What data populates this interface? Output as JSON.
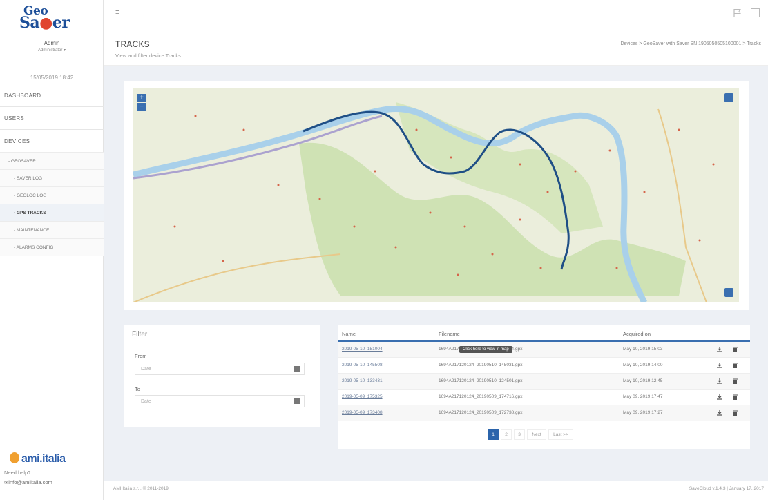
{
  "brand": {
    "logo_top": "Geo",
    "logo_bottom_a": "Sa",
    "logo_bottom_b": "er",
    "company_logo": "ami.italia"
  },
  "user": {
    "name": "Admin",
    "role": "Administrator",
    "datetime": "15/05/2019 18:42"
  },
  "nav": {
    "items": [
      {
        "label": "DASHBOARD"
      },
      {
        "label": "USERS"
      },
      {
        "label": "DEVICES"
      }
    ],
    "subitems": [
      {
        "label": "- GEOSAVER"
      },
      {
        "label": "- SAVER LOG"
      },
      {
        "label": "- GEOLOC LOG"
      },
      {
        "label": "- GPS TRACKS"
      },
      {
        "label": "- MAINTENANCE"
      },
      {
        "label": "- ALARMS CONFIG"
      }
    ]
  },
  "sidebar_footer": {
    "help": "Need help?",
    "email": "info@amiitalia.com"
  },
  "header": {
    "title": "TRACKS",
    "subtitle": "View and filter device Tracks",
    "breadcrumb": "Devices > GeoSaver with Saver SN 1905050505100001 > Tracks"
  },
  "map": {
    "zoom_in": "+",
    "zoom_out": "−",
    "route_color": "#1f4f86",
    "river_color": "#a9d0ea",
    "forest_color": "#cfe2b4"
  },
  "filter": {
    "title": "Filter",
    "from_label": "From",
    "from_placeholder": "Date",
    "to_label": "To",
    "to_placeholder": "Date"
  },
  "table": {
    "headers": {
      "name": "Name",
      "filename": "Filename",
      "acquired": "Acquired on"
    },
    "tooltip": "Click here to view in map",
    "rows": [
      {
        "name": "2019-05-10_151004",
        "filename": "1694A217120124_20190510_151004.gpx",
        "acquired": "May 10, 2019 15:03"
      },
      {
        "name": "2019-05-10_145508",
        "filename": "1694A217120124_20190510_145031.gpx",
        "acquired": "May 10, 2019 14:00"
      },
      {
        "name": "2019-05-10_133431",
        "filename": "1694A217120124_20190510_124501.gpx",
        "acquired": "May 10, 2019 12:45"
      },
      {
        "name": "2019-05-09_175325",
        "filename": "1694A217120124_20190509_174716.gpx",
        "acquired": "May 09, 2019 17:47"
      },
      {
        "name": "2019-05-09_173408",
        "filename": "1694A217120124_20190509_172738.gpx",
        "acquired": "May 09, 2019 17:27"
      }
    ],
    "pager": {
      "p1": "1",
      "p2": "2",
      "p3": "3",
      "next": "Next",
      "last": "Last >>"
    }
  },
  "footer": {
    "left": "AMI Italia s.r.l. © 2011-2019",
    "right": "SaveCloud v.1.4.3 | January 17, 2017"
  }
}
